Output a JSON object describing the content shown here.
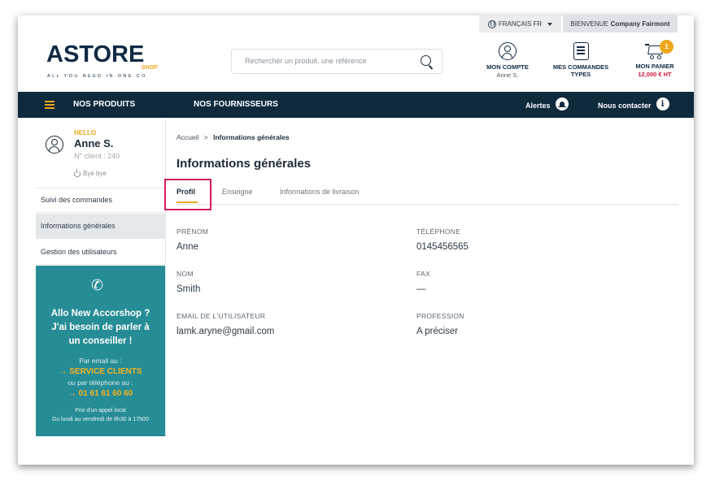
{
  "topbar": {
    "language": "FRANÇAIS FR",
    "welcome_prefix": "BIENVENUE",
    "company": "Company Fairmont"
  },
  "header": {
    "logo_main": "ASTORE",
    "logo_sub": "SHOP",
    "logo_tagline": "ALL YOU NEED IN ONE CO",
    "search_placeholder": "Rechercher un produit, une référence",
    "account_label": "MON COMPTE",
    "account_user": "Anne S.",
    "orders_label_1": "MES COMMANDES",
    "orders_label_2": "TYPES",
    "cart_label": "MON PANIER",
    "cart_total": "12,000 € HT",
    "cart_count": "1"
  },
  "nav": {
    "products": "NOS PRODUITS",
    "suppliers": "NOS FOURNISSEURS",
    "alerts": "Alertes",
    "contact": "Nous contacter"
  },
  "sidebar": {
    "hello": "HELLO",
    "name": "Anne S.",
    "client_number": "N° client : 240",
    "logout": "Bye bye",
    "items": [
      {
        "label": "Suivi des commandes"
      },
      {
        "label": "Informations générales"
      },
      {
        "label": "Gestion des utilisateurs"
      }
    ],
    "contact": {
      "title_1": "Allo New Accorshop ?",
      "title_2": "J'ai besoin de parler à",
      "title_3": "un conseiller !",
      "by_email": "Par email au :",
      "email_link": "→  SERVICE CLIENTS",
      "by_phone": "ou par téléphone au :",
      "phone_link": "→  01 61 61 60 60",
      "fine_1": "Prix d'un appel local",
      "fine_2": "Du lundi au vendredi de 8h30 à 17h00"
    }
  },
  "main": {
    "breadcrumb_home": "Accueil",
    "breadcrumb_sep": ">",
    "breadcrumb_current": "Informations générales",
    "title": "Informations générales",
    "tabs": [
      {
        "label": "Profil"
      },
      {
        "label": "Enseigne"
      },
      {
        "label": "Informations de livraison"
      }
    ],
    "fields": {
      "first_name_label": "PRÉNOM",
      "first_name": "Anne",
      "phone_label": "TÉLÉPHONE",
      "phone": "0145456565",
      "last_name_label": "NOM",
      "last_name": "Smith",
      "fax_label": "FAX",
      "fax": "—",
      "email_label": "EMAIL DE L'UTILISATEUR",
      "email": "lamk.aryne@gmail.com",
      "profession_label": "PROFESSION",
      "profession": "A préciser"
    }
  },
  "colors": {
    "navy": "#0f2a3d",
    "accent": "#e8a91c",
    "teal": "#268c95",
    "highlight": "#d81d5c"
  }
}
